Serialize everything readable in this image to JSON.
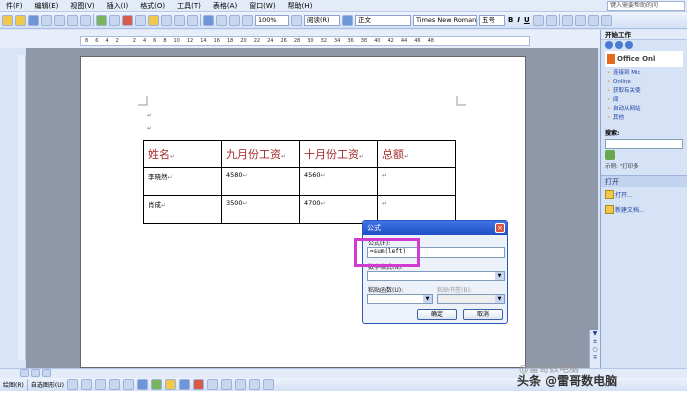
{
  "menu": {
    "items": [
      "件(F)",
      "编辑(E)",
      "视图(V)",
      "插入(I)",
      "格式(O)",
      "工具(T)",
      "表格(A)",
      "窗口(W)",
      "帮助(H)"
    ],
    "help_box": "键入需要帮助的问"
  },
  "toolbar": {
    "zoom": "100%",
    "reading_label": "阅读(R)",
    "style": "正文",
    "font": "Times New Roman",
    "size": "五号",
    "bold": "B",
    "italic": "I",
    "underline": "U"
  },
  "ruler": {
    "ticks": [
      "8",
      "6",
      "4",
      "2",
      "",
      "2",
      "4",
      "6",
      "8",
      "10",
      "12",
      "14",
      "16",
      "18",
      "20",
      "22",
      "24",
      "26",
      "28",
      "30",
      "32",
      "34",
      "36",
      "38",
      "40",
      "42",
      "44",
      "46",
      "48"
    ]
  },
  "document": {
    "table": {
      "headers": [
        "姓名",
        "九月份工资",
        "十月份工资",
        "总额"
      ],
      "rows": [
        [
          "李晓然",
          "4580",
          "4560",
          ""
        ],
        [
          "肖成",
          "3500",
          "4700",
          ""
        ]
      ]
    },
    "return_mark": "↵"
  },
  "formula_dialog": {
    "title": "公式",
    "formula_label": "公式(F):",
    "formula_value": "=sum(left)",
    "number_format_label": "数字格式(N):",
    "paste_function_label": "粘贴函数(U):",
    "paste_bookmark_label": "粘贴书签(B):",
    "ok": "确定",
    "cancel": "取消",
    "close": "×"
  },
  "task_pane": {
    "title": "开始工作",
    "logo": "Office Onl",
    "links": [
      "连接到 Mic",
      "Online",
      "获取有关使",
      "闻",
      "自动从网站",
      "其他"
    ],
    "search_label": "搜索:",
    "example": "示例: \"打印多",
    "open_section": "打开",
    "open_item": "打开...",
    "new_doc": "新建文档..."
  },
  "drawing": {
    "draw_label": "绘图(R)",
    "autoshape_label": "自选图形(U)"
  },
  "watermark": {
    "top": "@雷哥数电脑",
    "main": "头条 @雷哥数电脑"
  }
}
